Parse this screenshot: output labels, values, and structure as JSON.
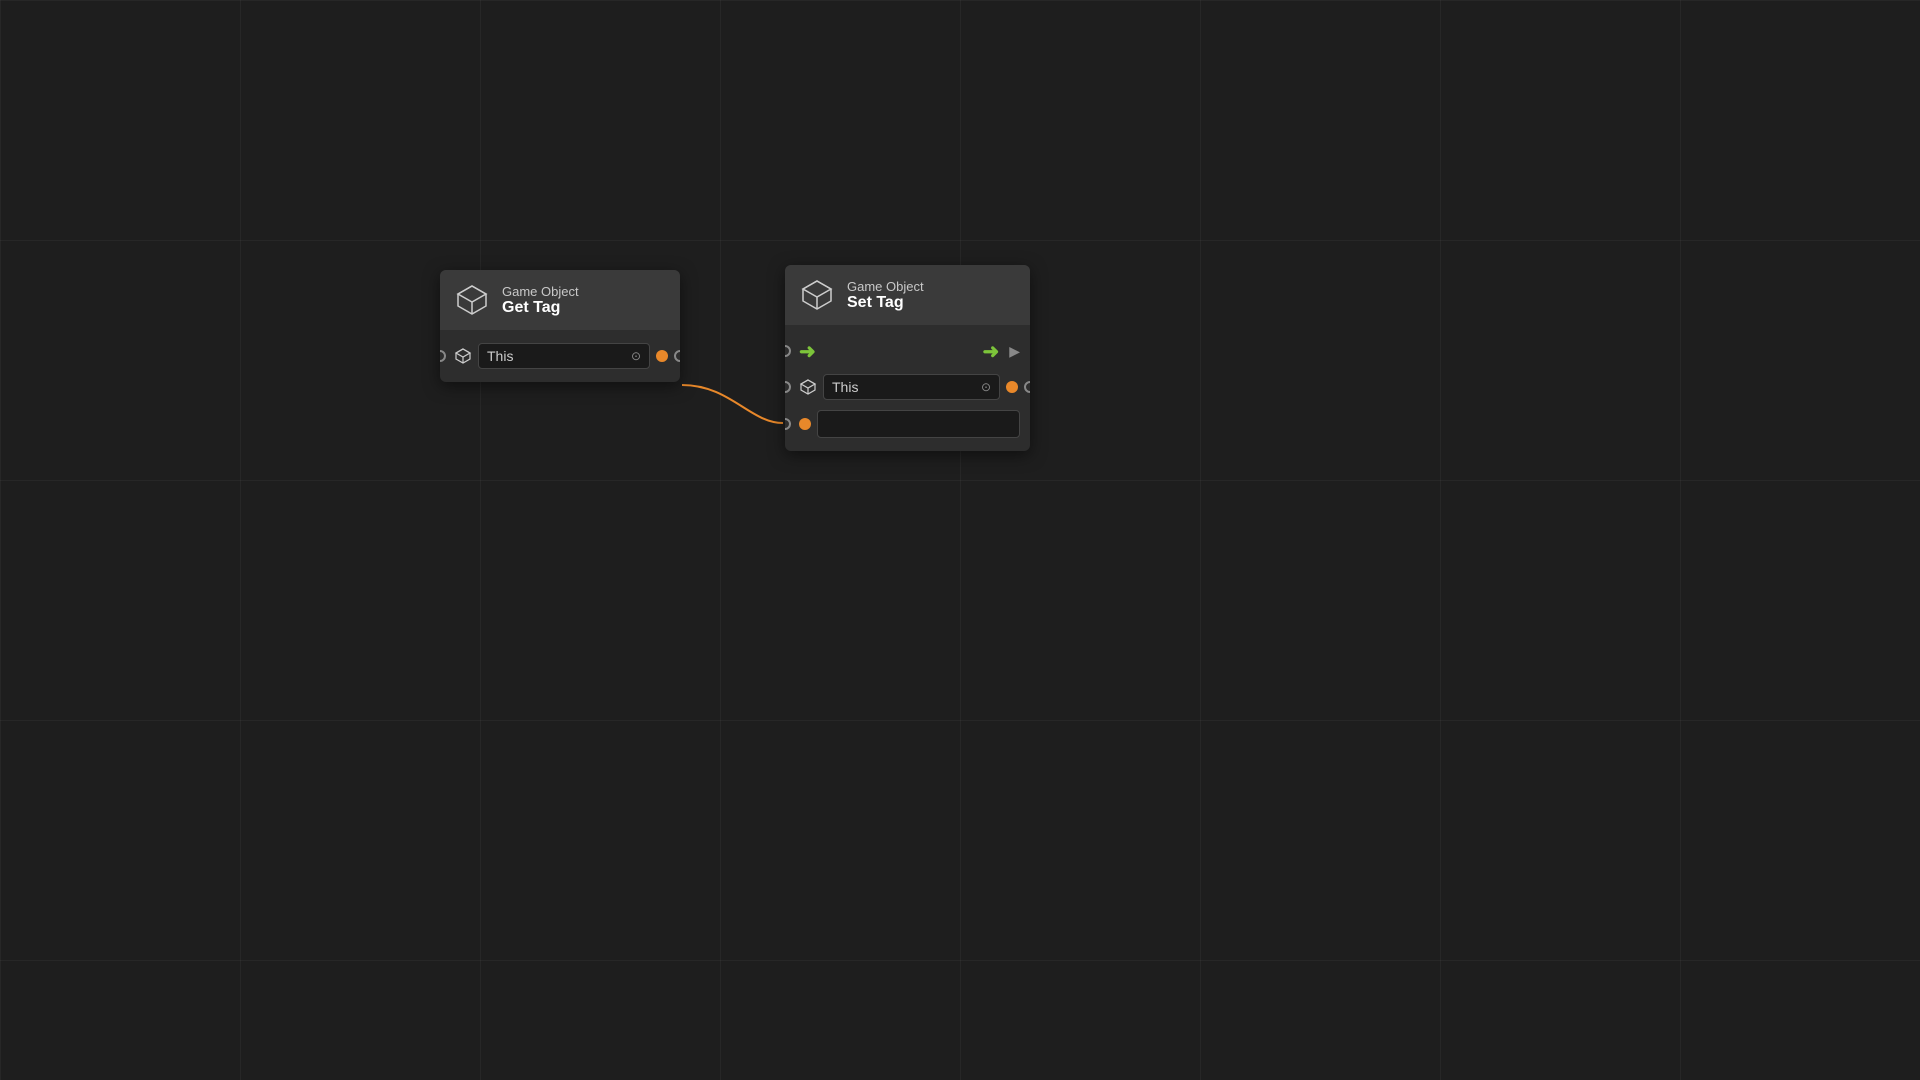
{
  "canvas": {
    "background": "#1e1e1e",
    "grid_color": "rgba(255,255,255,0.04)"
  },
  "nodes": {
    "get_tag": {
      "title_top": "Game Object",
      "title_bottom": "Get Tag",
      "input_value": "This",
      "input_placeholder": "This"
    },
    "set_tag": {
      "title_top": "Game Object",
      "title_bottom": "Set Tag",
      "input_value": "This",
      "input_placeholder": "This"
    }
  },
  "colors": {
    "orange": "#e8882a",
    "green": "#7cc43a",
    "node_bg": "#2d2d2d",
    "header_bg": "#3a3a3a",
    "port_border": "#888888"
  }
}
